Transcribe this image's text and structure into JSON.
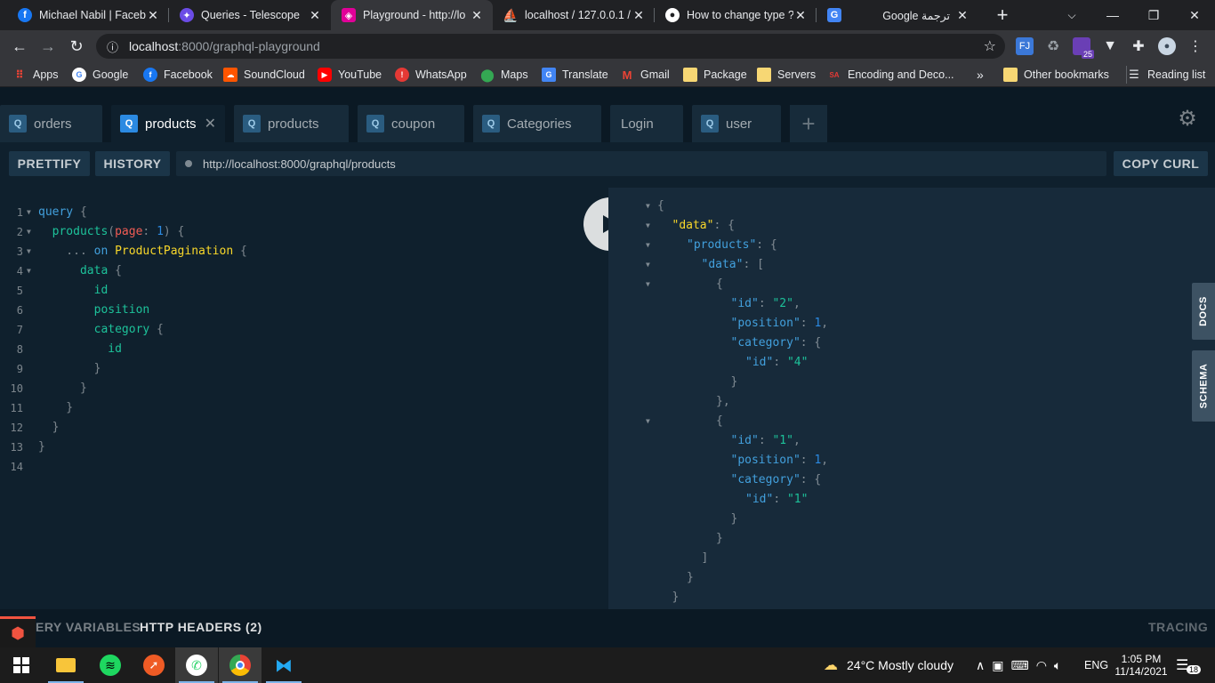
{
  "browser": {
    "tabs": [
      {
        "title": "Michael Nabil | Facebo",
        "icon": "facebook-icon",
        "color": "#1877f2"
      },
      {
        "title": "Queries - Telescope",
        "icon": "telescope-icon",
        "color": "#6b4ce6"
      },
      {
        "title": "Playground - http://lo",
        "icon": "graphql-icon",
        "color": "#e10098"
      },
      {
        "title": "localhost / 127.0.0.1 /",
        "icon": "phpmyadmin-icon",
        "color": "#f29111"
      },
      {
        "title": "How to change type ?",
        "icon": "github-icon",
        "color": "#ffffff"
      },
      {
        "title": "Google ترجمة",
        "icon": "google-translate-icon",
        "color": "#4285f4"
      }
    ],
    "address": {
      "host": "localhost",
      "path": ":8000/graphql-playground"
    },
    "extension_badge": "25"
  },
  "bookmarks": {
    "items": [
      "Apps",
      "Google",
      "Facebook",
      "SoundCloud",
      "YouTube",
      "WhatsApp",
      "Maps",
      "Translate",
      "Gmail",
      "Package",
      "Servers",
      "Encoding and Deco..."
    ],
    "overflow": "»",
    "other": "Other bookmarks",
    "reading_list": "Reading list"
  },
  "playground": {
    "tabs": [
      {
        "label": "orders",
        "badge": "Q"
      },
      {
        "label": "products",
        "badge": "Q"
      },
      {
        "label": "products",
        "badge": "Q"
      },
      {
        "label": "coupon",
        "badge": "Q"
      },
      {
        "label": "Categories",
        "badge": "Q"
      },
      {
        "label": "Login",
        "badge": ""
      },
      {
        "label": "user",
        "badge": "Q"
      }
    ],
    "add_tab": "+",
    "prettify_label": "PRETTIFY",
    "history_label": "HISTORY",
    "endpoint": "http://localhost:8000/graphql/products",
    "copy_curl_label": "COPY CURL",
    "docs_label": "DOCS",
    "schema_label": "SCHEMA",
    "query_variables_label": "ERY VARIABLES",
    "http_headers_label": "HTTP HEADERS (2)",
    "tracing_label": "TRACING",
    "line_numbers": [
      "1",
      "2",
      "3",
      "4",
      "5",
      "6",
      "7",
      "8",
      "9",
      "10",
      "11",
      "12",
      "13",
      "14"
    ]
  },
  "taskbar": {
    "weather": "24°C  Mostly cloudy",
    "lang": "ENG",
    "time": "1:05 PM",
    "date": "11/14/2021",
    "notifications": "18"
  }
}
